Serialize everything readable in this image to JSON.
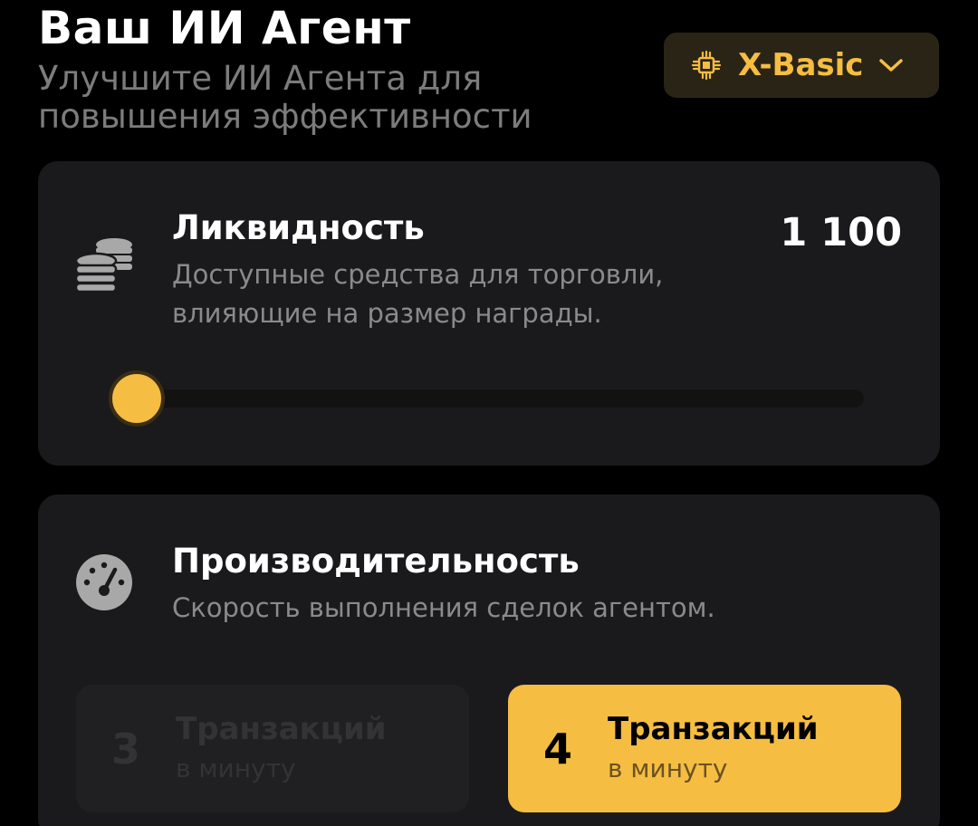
{
  "header": {
    "title": "Ваш ИИ Агент",
    "subtitle": "Улучшите ИИ Агента для повышения эффективности"
  },
  "plan_select": {
    "label": "X-Basic",
    "icon": "chip-icon",
    "chevron": "chevron-down-icon"
  },
  "liquidity": {
    "title": "Ликвидность",
    "description": "Доступные средства для торговли, влияющие на размер награды.",
    "value": "1 100",
    "icon": "coins-icon",
    "slider_fraction": 0
  },
  "performance": {
    "title": "Производительность",
    "description": "Скорость выполнения сделок агентом.",
    "icon": "speedometer-icon",
    "options": [
      {
        "number": "3",
        "title": "Транзакций",
        "subtitle": "в минуту",
        "selected": false
      },
      {
        "number": "4",
        "title": "Транзакций",
        "subtitle": "в минуту",
        "selected": true
      }
    ]
  },
  "colors": {
    "accent": "#f5bd42",
    "background": "#000000",
    "card": "#1a1a1c",
    "muted_text": "#7c7c7c"
  }
}
